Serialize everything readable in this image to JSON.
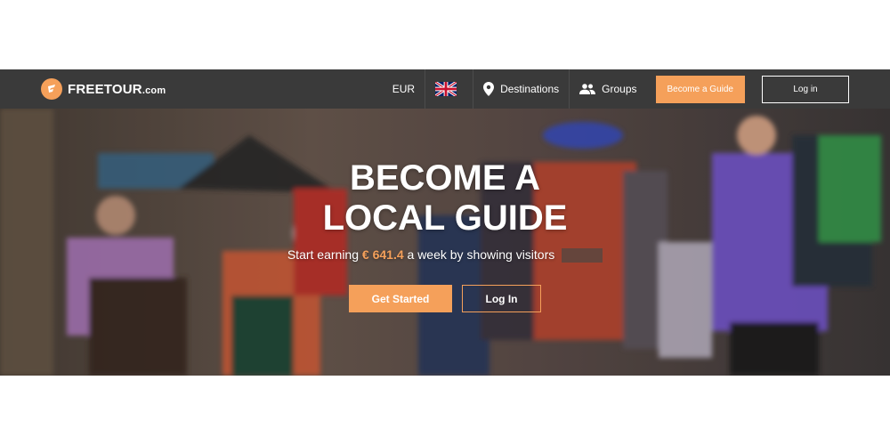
{
  "header": {
    "logo_text": "FREETOUR",
    "logo_domain": ".com",
    "currency": "EUR",
    "language_flag": "uk-flag-icon",
    "destinations_label": "Destinations",
    "groups_label": "Groups",
    "become_guide_label": "Become a Guide",
    "login_label": "Log in"
  },
  "hero": {
    "title_line1": "BECOME A",
    "title_line2": "LOCAL GUIDE",
    "subtitle_before": "Start earning",
    "subtitle_amount": "€ 641.4",
    "subtitle_after": "a week by showing visitors",
    "get_started_label": "Get Started",
    "login_label": "Log In"
  },
  "colors": {
    "accent": "#f5a05a",
    "navbar_bg": "#3a3a3a",
    "text_light": "#ffffff"
  },
  "icons": {
    "location": "location-pin-icon",
    "groups": "people-icon",
    "logo": "freetour-logo-icon"
  }
}
